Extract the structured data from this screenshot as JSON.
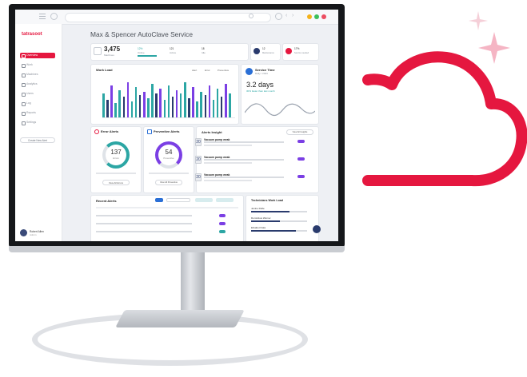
{
  "dashboard": {
    "title": "Max & Spencer AutoClave Service",
    "brand": "tatrasoot"
  },
  "sidebar": {
    "items": [
      {
        "label": "Overview",
        "active": true
      },
      {
        "label": "Work",
        "active": false
      },
      {
        "label": "Machines",
        "active": false
      },
      {
        "label": "Analytics",
        "active": false
      },
      {
        "label": "Users",
        "active": false
      },
      {
        "label": "Log",
        "active": false
      },
      {
        "label": "Reports",
        "active": false
      },
      {
        "label": "Settings",
        "active": false
      }
    ],
    "button_label": "Create New Alert",
    "user_name": "Robert Allen",
    "user_role": "Admin"
  },
  "kpis": {
    "main_value": "3,475",
    "main_label": "Machines",
    "items": [
      {
        "value": "12%",
        "label": "Online"
      },
      {
        "value": "121",
        "label": "Active"
      },
      {
        "value": "18",
        "label": "Idle"
      }
    ],
    "badges": [
      {
        "value": "12",
        "label": "Maintenance",
        "color": "#2a3b6d"
      },
      {
        "value": "17%",
        "label": "Service needed",
        "color": "#e5173f"
      }
    ]
  },
  "work_load": {
    "title": "Work Load",
    "legend": [
      "Alert",
      "Error",
      "Preventive"
    ]
  },
  "service_time": {
    "title": "Service Time",
    "sub": "Daily / 2023",
    "value": "3.2 days",
    "note": "30% faster than last month"
  },
  "error_alerts": {
    "title": "Error Alerts",
    "value": "137",
    "label": "Errors",
    "button": "View All Errors"
  },
  "preventive_alerts": {
    "title": "Preventive Alerts",
    "value": "54",
    "label": "Preventive",
    "button": "View All Preventive"
  },
  "alerts_insight": {
    "title": "Alerts Insight",
    "button": "View All Insights",
    "rows": [
      {
        "day": "20",
        "title": "Vacuum pump weak"
      },
      {
        "day": "20",
        "title": "Vacuum pump weak"
      },
      {
        "day": "20",
        "title": "Vacuum pump weak"
      }
    ]
  },
  "recent_alerts": {
    "title": "Recent Alerts"
  },
  "technicians": {
    "title": "Technicians Work Load",
    "items": [
      "Jenine Rolfe",
      "Dominikus Werner",
      "Elisabet Fiala"
    ]
  },
  "colors": {
    "accent": "#e5173f",
    "navy": "#2a3b6d",
    "teal": "#2ca6a4",
    "purple": "#7b3fe4",
    "cloud": "#e5173f"
  },
  "icons": [
    "hamburger-icon",
    "back-icon",
    "search-icon",
    "refresh-icon",
    "sparkle-icon",
    "cloud-icon",
    "help-icon"
  ]
}
